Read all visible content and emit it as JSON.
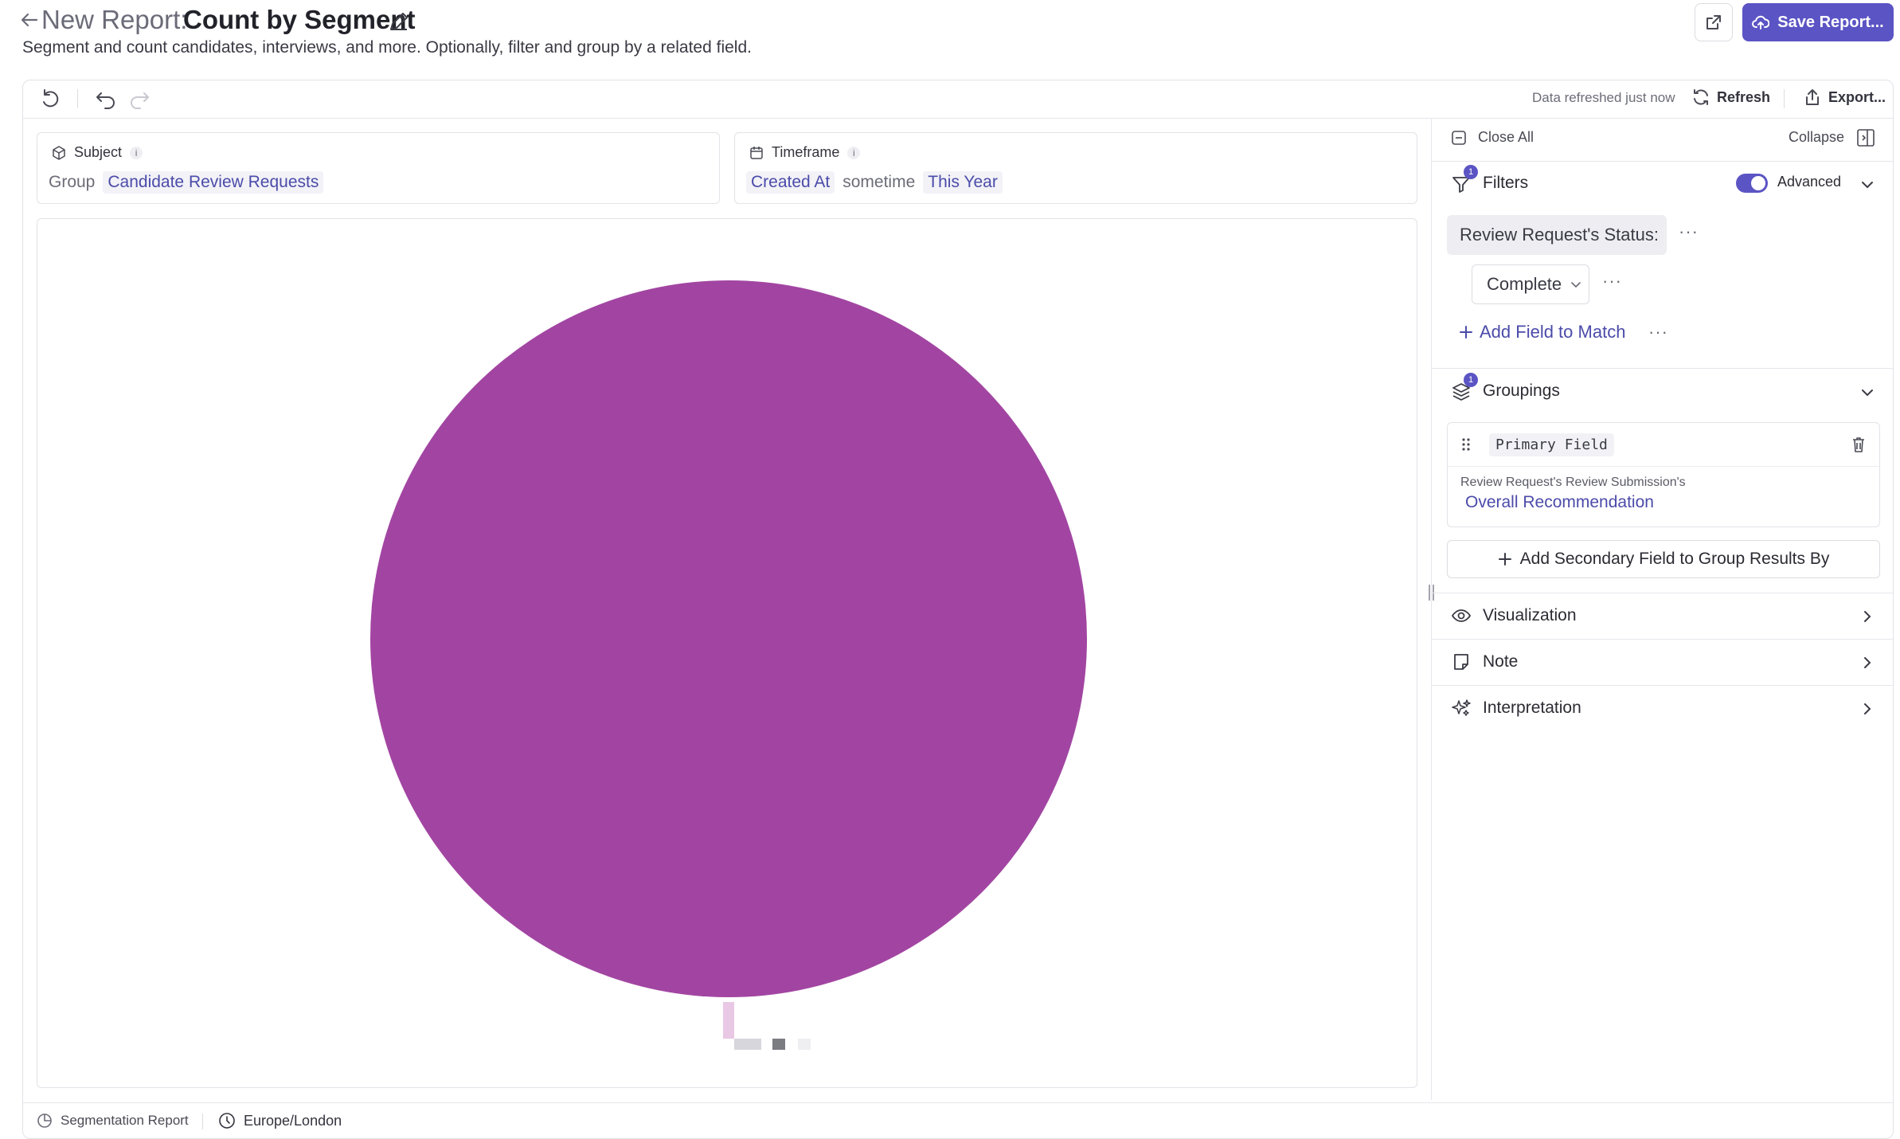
{
  "header": {
    "title_prefix": "New Report:",
    "title_name": "Count by Segment",
    "subtitle": "Segment and count candidates, interviews, and more. Optionally, filter and group by a related field.",
    "save_label": "Save Report..."
  },
  "toolbar": {
    "refreshed_text": "Data refreshed just now",
    "refresh_label": "Refresh",
    "export_label": "Export..."
  },
  "subject": {
    "label": "Subject",
    "info": "i",
    "prefix": "Group",
    "value": "Candidate Review Requests"
  },
  "timeframe": {
    "label": "Timeframe",
    "info": "i",
    "field": "Created At",
    "operator": "sometime",
    "value": "This Year"
  },
  "chart_data": {
    "type": "pie",
    "categories": [
      ""
    ],
    "values": [
      1
    ],
    "colors": [
      "#a245a2"
    ]
  },
  "panel": {
    "close_all": "Close All",
    "collapse": "Collapse",
    "filters": {
      "title": "Filters",
      "badge": "1",
      "advanced_label": "Advanced",
      "advanced_on": true,
      "field": "Review Request's Status:",
      "value": "Complete",
      "add_field": "Add Field to Match",
      "more": "···"
    },
    "groupings": {
      "title": "Groupings",
      "badge": "1",
      "primary_label": "Primary Field",
      "path": "Review Request's Review Submission's",
      "field": "Overall Recommendation",
      "add_secondary": "Add Secondary Field to Group Results By"
    },
    "visualization": {
      "title": "Visualization"
    },
    "note": {
      "title": "Note"
    },
    "interpretation": {
      "title": "Interpretation"
    }
  },
  "footer": {
    "report_type": "Segmentation Report",
    "timezone": "Europe/London"
  },
  "colors": {
    "accent": "#5b54c4",
    "link": "#4b4baa",
    "pie": "#a245a2"
  }
}
